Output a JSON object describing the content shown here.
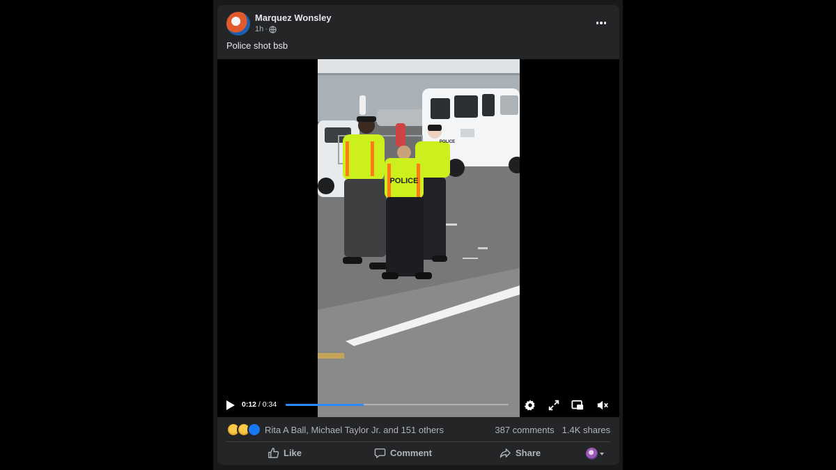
{
  "post": {
    "author": "Marquez Wonsley",
    "time": "1h",
    "separator": "·",
    "caption": "Police shot bsb"
  },
  "video": {
    "current_time": "0:12",
    "duration_text": " / 0:34",
    "progress": 0.35,
    "frame_text": {
      "vest_label": "POLICE",
      "van_label": "POLICE"
    }
  },
  "engagement": {
    "reactions": [
      "sad",
      "wow",
      "like"
    ],
    "reacted_by": "Rita A Ball, Michael Taylor Jr. and 151 others",
    "comments": "387 comments",
    "shares": "1.4K shares"
  },
  "actions": {
    "like": "Like",
    "comment": "Comment",
    "share": "Share"
  },
  "icons": [
    "globe-icon",
    "more-options-icon",
    "play-icon",
    "settings-icon",
    "fullscreen-icon",
    "picture-in-picture-icon",
    "volume-muted-icon",
    "like-icon",
    "comment-icon",
    "share-icon"
  ],
  "colors": {
    "accent": "#2d88ff",
    "like_blue": "#1877f2",
    "card": "#242526",
    "text_secondary": "#b0b3b8"
  }
}
